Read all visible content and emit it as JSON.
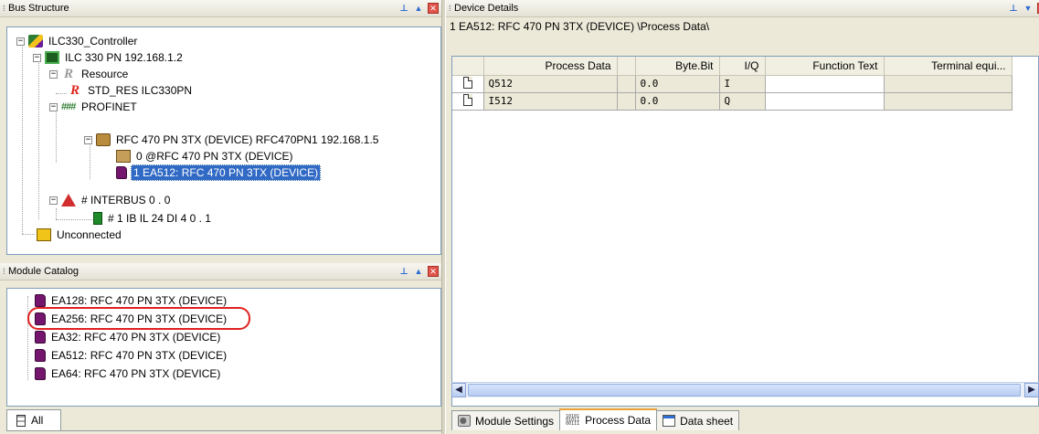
{
  "bus_structure": {
    "title": "Bus Structure",
    "nodes": [
      {
        "label": "ILC330_Controller"
      },
      {
        "label": "ILC 330 PN 192.168.1.2"
      },
      {
        "label": "Resource"
      },
      {
        "label": "STD_RES ILC330PN"
      },
      {
        "label": "PROFINET"
      },
      {
        "label": "RFC 470 PN 3TX (DEVICE) RFC470PN1 192.168.1.5"
      },
      {
        "label": "0 @RFC 470 PN 3TX (DEVICE)"
      },
      {
        "label": "1 EA512: RFC 470 PN 3TX (DEVICE)"
      },
      {
        "label": "# INTERBUS 0 . 0"
      },
      {
        "label": "# 1 IB IL 24 DI 4 0 . 1"
      },
      {
        "label": "Unconnected"
      }
    ],
    "selected": "1 EA512: RFC 470 PN 3TX (DEVICE)"
  },
  "module_catalog": {
    "title": "Module Catalog",
    "items": [
      {
        "label": "EA128: RFC 470 PN 3TX (DEVICE)"
      },
      {
        "label": "EA256: RFC 470 PN 3TX (DEVICE)"
      },
      {
        "label": "EA32: RFC 470 PN 3TX (DEVICE)"
      },
      {
        "label": "EA512: RFC 470 PN 3TX (DEVICE)"
      },
      {
        "label": "EA64: RFC 470 PN 3TX (DEVICE)"
      }
    ],
    "highlighted": "EA256: RFC 470 PN 3TX (DEVICE)",
    "bottom_tab": "All"
  },
  "device_details": {
    "title": "Device Details",
    "path": "1 EA512: RFC 470 PN 3TX (DEVICE) \\Process Data\\",
    "columns": [
      "Process Data",
      "Byte.Bit",
      "I/Q",
      "Function Text",
      "Terminal equi..."
    ],
    "rows": [
      {
        "name": "Q512",
        "byte_bit": "0.0",
        "iq": "I",
        "function_text": "",
        "terminal": ""
      },
      {
        "name": "I512",
        "byte_bit": "0.0",
        "iq": "Q",
        "function_text": "",
        "terminal": ""
      }
    ],
    "tabs": [
      {
        "label": "Module Settings",
        "icon": "module-settings-icon"
      },
      {
        "label": "Process Data",
        "icon": "process-data-icon",
        "active": true
      },
      {
        "label": "Data sheet",
        "icon": "data-sheet-icon"
      }
    ]
  },
  "colors": {
    "selection": "#316ac5",
    "highlight_circle": "#e02020",
    "active_tab_accent": "#e6a23c",
    "device_purple": "#74166d"
  }
}
